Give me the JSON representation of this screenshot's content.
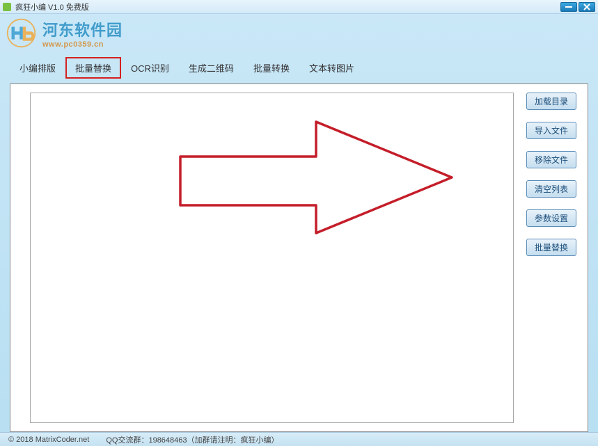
{
  "titlebar": {
    "title": "疯狂小编 V1.0  免费版"
  },
  "watermark": {
    "title": "河东软件园",
    "url": "www.pc0359.cn"
  },
  "tabs": [
    {
      "label": "小编排版",
      "highlighted": false
    },
    {
      "label": "批量替换",
      "highlighted": true
    },
    {
      "label": "OCR识别",
      "highlighted": false
    },
    {
      "label": "生成二维码",
      "highlighted": false
    },
    {
      "label": "批量转换",
      "highlighted": false
    },
    {
      "label": "文本转图片",
      "highlighted": false
    }
  ],
  "side_buttons": [
    {
      "label": "加载目录"
    },
    {
      "label": "导入文件"
    },
    {
      "label": "移除文件"
    },
    {
      "label": "清空列表"
    },
    {
      "label": "参数设置"
    },
    {
      "label": "批量替换"
    }
  ],
  "footer": {
    "copyright": "© 2018 MatrixCoder.net",
    "qq_group": "QQ交流群：198648463（加群请注明：疯狂小编）"
  },
  "annotation": {
    "arrow_color": "#c41e2a"
  }
}
